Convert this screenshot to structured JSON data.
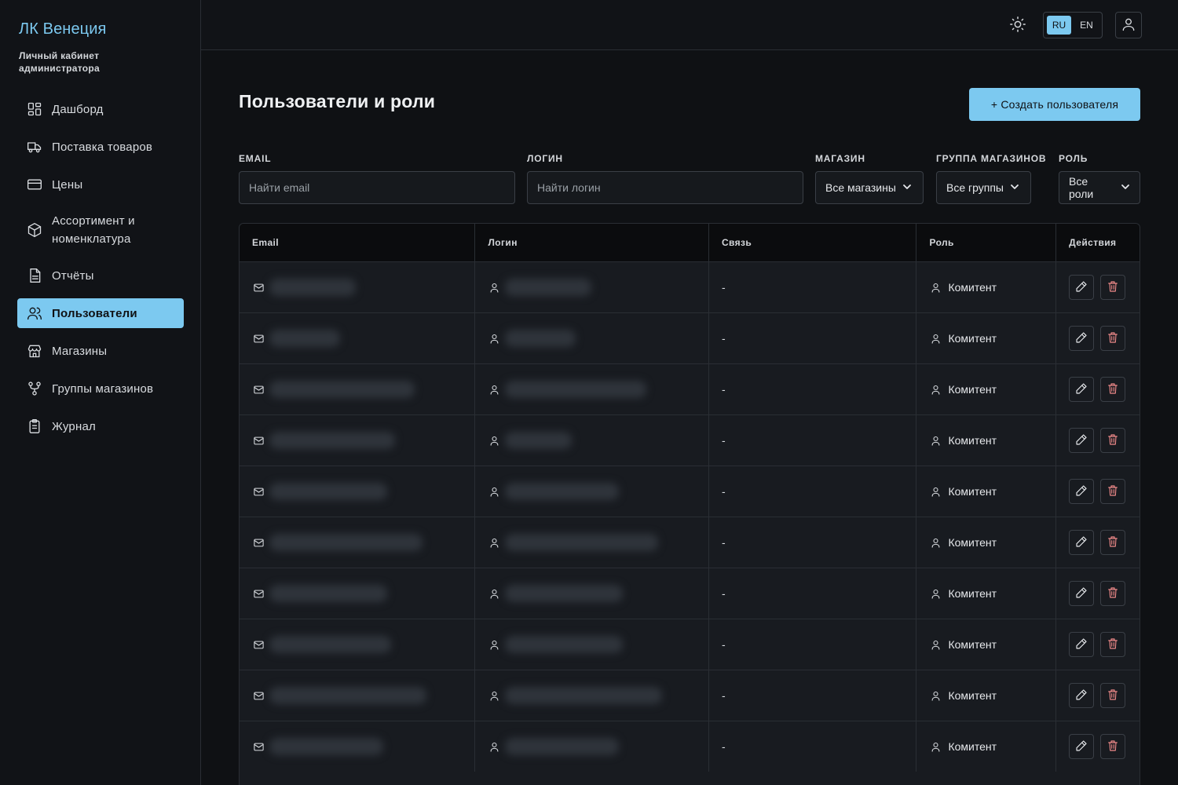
{
  "app": {
    "title": "ЛК Венеция",
    "subtitle": "Личный кабинет администратора"
  },
  "sidebar": {
    "items": [
      {
        "label": "Дашборд",
        "icon": "dashboard-icon"
      },
      {
        "label": "Поставка товаров",
        "icon": "truck-icon"
      },
      {
        "label": "Цены",
        "icon": "credit-card-icon"
      },
      {
        "label": "Ассортимент и номенклатура",
        "icon": "box-icon"
      },
      {
        "label": "Отчёты",
        "icon": "document-icon"
      },
      {
        "label": "Пользователи",
        "icon": "users-icon",
        "active": true
      },
      {
        "label": "Магазины",
        "icon": "store-icon"
      },
      {
        "label": "Группы магазинов",
        "icon": "network-icon"
      },
      {
        "label": "Журнал",
        "icon": "clipboard-icon"
      }
    ]
  },
  "topbar": {
    "theme_icon": "sun-icon",
    "lang": {
      "ru": "RU",
      "en": "EN",
      "selected": "RU"
    },
    "profile_icon": "user-icon"
  },
  "page": {
    "title": "Пользователи и роли",
    "create_button": "+ Создать пользователя"
  },
  "filters": {
    "email": {
      "label": "EMAIL",
      "placeholder": "Найти email"
    },
    "login": {
      "label": "ЛОГИН",
      "placeholder": "Найти логин"
    },
    "store": {
      "label": "МАГАЗИН",
      "value": "Все магазины"
    },
    "store_group": {
      "label": "ГРУППА МАГАЗИНОВ",
      "value": "Все группы"
    },
    "role": {
      "label": "РОЛЬ",
      "value": "Все роли"
    }
  },
  "table": {
    "columns": {
      "email": "Email",
      "login": "Логин",
      "link": "Связь",
      "role": "Роль",
      "actions": "Действия"
    },
    "rows": [
      {
        "link": "-",
        "role": "Комитент"
      },
      {
        "link": "-",
        "role": "Комитент"
      },
      {
        "link": "-",
        "role": "Комитент"
      },
      {
        "link": "-",
        "role": "Комитент"
      },
      {
        "link": "-",
        "role": "Комитент"
      },
      {
        "link": "-",
        "role": "Комитент"
      },
      {
        "link": "-",
        "role": "Комитент"
      },
      {
        "link": "-",
        "role": "Комитент"
      },
      {
        "link": "-",
        "role": "Комитент"
      },
      {
        "link": "-",
        "role": "Комитент"
      }
    ]
  },
  "colors": {
    "accent": "#7cc9f0",
    "background": "#0f1114",
    "danger": "#f08a8a"
  }
}
